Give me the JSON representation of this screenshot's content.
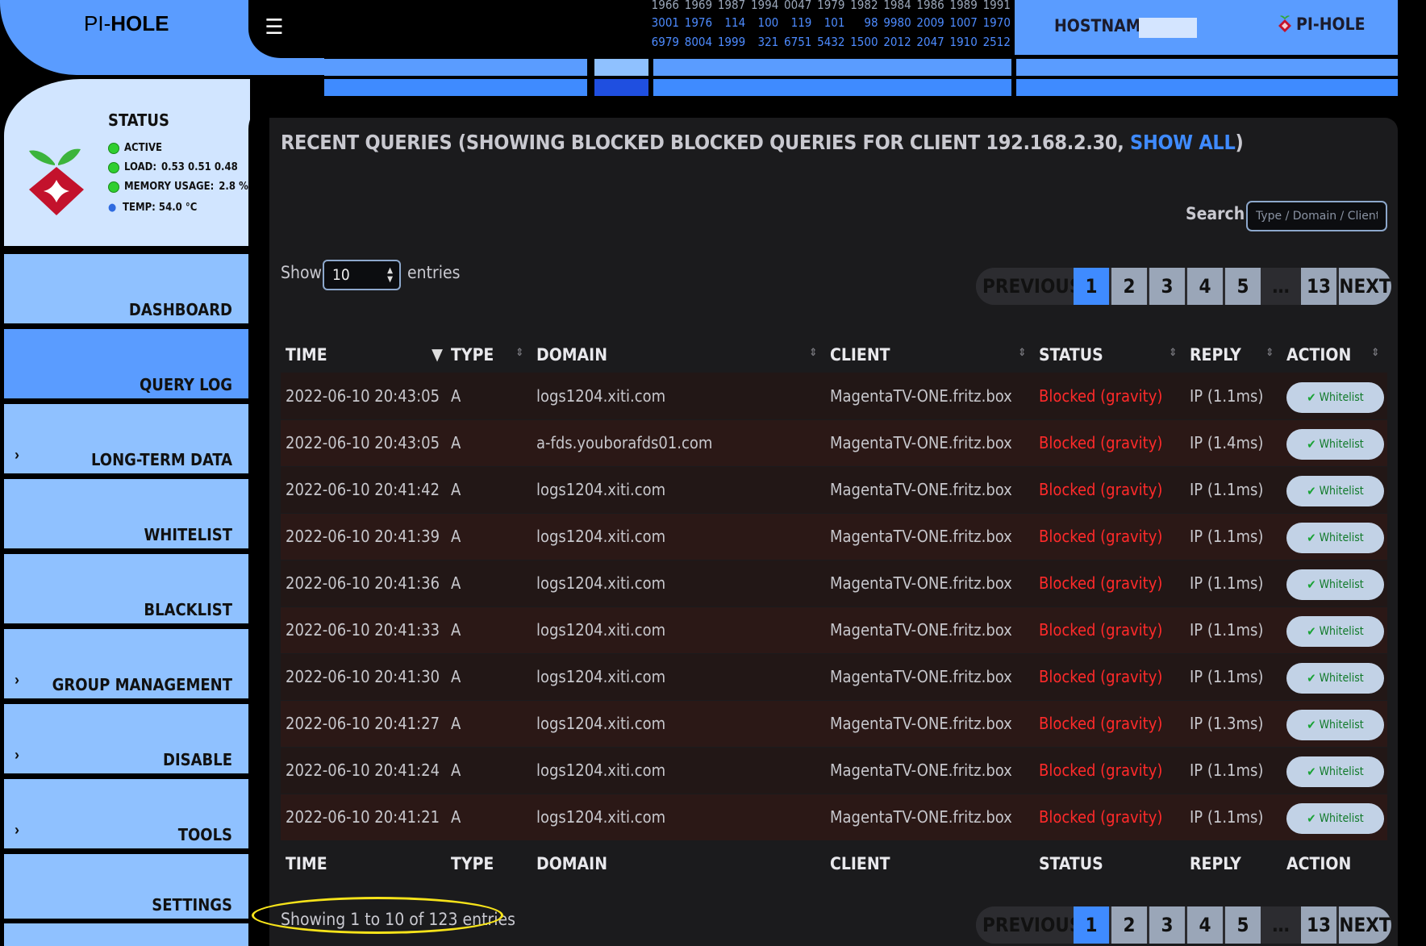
{
  "header": {
    "logo_light": "PI-",
    "logo_bold": "HOLE",
    "menu_icon": "hamburger-icon",
    "numbers": [
      [
        "1966",
        "1969",
        "1987",
        "1994",
        "0047",
        "1979",
        "1982",
        "1984",
        "1986",
        "1989",
        "1991"
      ],
      [
        "3001",
        "1976",
        "114",
        "100",
        "119",
        "101",
        "98",
        "9980",
        "2009",
        "1007",
        "1970"
      ],
      [
        "6979",
        "8004",
        "1999",
        "321",
        "6751",
        "5432",
        "1500",
        "2012",
        "2047",
        "1910",
        "2512"
      ]
    ],
    "hostname_label": "HOSTNAME:",
    "brand_right": "PI-HOLE"
  },
  "status": {
    "title": "STATUS",
    "active": "ACTIVE",
    "load_label": "LOAD:",
    "load_value": "0.53  0.51  0.48",
    "memory_label": "MEMORY USAGE:",
    "memory_value": "2.8 %",
    "temp": "TEMP: 54.0 °C"
  },
  "sidebar": {
    "items": [
      {
        "label": "DASHBOARD",
        "chevron": ""
      },
      {
        "label": "QUERY LOG",
        "chevron": ""
      },
      {
        "label": "LONG-TERM DATA",
        "chevron": "›"
      },
      {
        "label": "WHITELIST",
        "chevron": ""
      },
      {
        "label": "BLACKLIST",
        "chevron": ""
      },
      {
        "label": "GROUP MANAGEMENT",
        "chevron": "›"
      },
      {
        "label": "DISABLE",
        "chevron": "›"
      },
      {
        "label": "TOOLS",
        "chevron": "›"
      },
      {
        "label": "SETTINGS",
        "chevron": ""
      }
    ]
  },
  "main": {
    "title_prefix": "RECENT QUERIES (SHOWING BLOCKED BLOCKED QUERIES FOR CLIENT 192.168.2.30, ",
    "title_link": "SHOW ALL",
    "title_suffix": ")",
    "search_label": "Search:",
    "search_placeholder": "Type / Domain / Client",
    "show_label": "Show",
    "show_value": "10",
    "entries_label": "entries",
    "pagination": {
      "previous": "PREVIOUS",
      "pages": [
        "1",
        "2",
        "3",
        "4",
        "5",
        "…",
        "13"
      ],
      "current": "1",
      "next": "NEXT"
    },
    "columns": [
      "TIME",
      "TYPE",
      "DOMAIN",
      "CLIENT",
      "STATUS",
      "REPLY",
      "ACTION"
    ],
    "rows": [
      {
        "time": "2022-06-10 20:43:05",
        "type": "A",
        "domain": "logs1204.xiti.com",
        "client": "MagentaTV-ONE.fritz.box",
        "status": "Blocked (gravity)",
        "reply": "IP (1.1ms)",
        "action": "Whitelist"
      },
      {
        "time": "2022-06-10 20:43:05",
        "type": "A",
        "domain": "a-fds.youborafds01.com",
        "client": "MagentaTV-ONE.fritz.box",
        "status": "Blocked (gravity)",
        "reply": "IP (1.4ms)",
        "action": "Whitelist"
      },
      {
        "time": "2022-06-10 20:41:42",
        "type": "A",
        "domain": "logs1204.xiti.com",
        "client": "MagentaTV-ONE.fritz.box",
        "status": "Blocked (gravity)",
        "reply": "IP (1.1ms)",
        "action": "Whitelist"
      },
      {
        "time": "2022-06-10 20:41:39",
        "type": "A",
        "domain": "logs1204.xiti.com",
        "client": "MagentaTV-ONE.fritz.box",
        "status": "Blocked (gravity)",
        "reply": "IP (1.1ms)",
        "action": "Whitelist"
      },
      {
        "time": "2022-06-10 20:41:36",
        "type": "A",
        "domain": "logs1204.xiti.com",
        "client": "MagentaTV-ONE.fritz.box",
        "status": "Blocked (gravity)",
        "reply": "IP (1.1ms)",
        "action": "Whitelist"
      },
      {
        "time": "2022-06-10 20:41:33",
        "type": "A",
        "domain": "logs1204.xiti.com",
        "client": "MagentaTV-ONE.fritz.box",
        "status": "Blocked (gravity)",
        "reply": "IP (1.1ms)",
        "action": "Whitelist"
      },
      {
        "time": "2022-06-10 20:41:30",
        "type": "A",
        "domain": "logs1204.xiti.com",
        "client": "MagentaTV-ONE.fritz.box",
        "status": "Blocked (gravity)",
        "reply": "IP (1.1ms)",
        "action": "Whitelist"
      },
      {
        "time": "2022-06-10 20:41:27",
        "type": "A",
        "domain": "logs1204.xiti.com",
        "client": "MagentaTV-ONE.fritz.box",
        "status": "Blocked (gravity)",
        "reply": "IP (1.3ms)",
        "action": "Whitelist"
      },
      {
        "time": "2022-06-10 20:41:24",
        "type": "A",
        "domain": "logs1204.xiti.com",
        "client": "MagentaTV-ONE.fritz.box",
        "status": "Blocked (gravity)",
        "reply": "IP (1.1ms)",
        "action": "Whitelist"
      },
      {
        "time": "2022-06-10 20:41:21",
        "type": "A",
        "domain": "logs1204.xiti.com",
        "client": "MagentaTV-ONE.fritz.box",
        "status": "Blocked (gravity)",
        "reply": "IP (1.1ms)",
        "action": "Whitelist"
      }
    ],
    "info": "Showing 1 to 10 of 123 entries"
  },
  "colors": {
    "accent": "#5a9cff",
    "accent_light": "#8fc1ff",
    "panel_light": "#d1e5ff",
    "link": "#3f8bff",
    "blocked": "#ff2a2a",
    "highlight": "#f6e31a"
  }
}
